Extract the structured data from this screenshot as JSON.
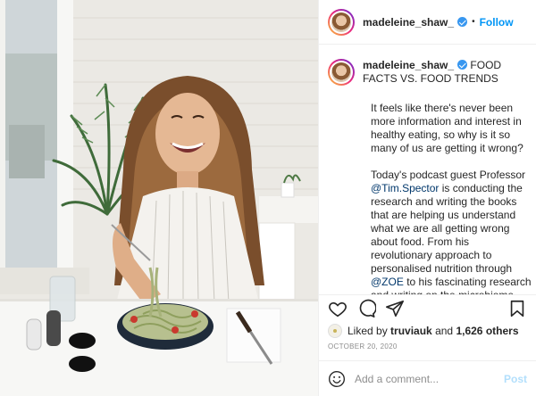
{
  "header": {
    "username": "madeleine_shaw_",
    "separator": "•",
    "follow_label": "Follow"
  },
  "caption": {
    "username": "madeleine_shaw_",
    "title": "FOOD FACTS VS. FOOD TRENDS",
    "para1": "It feels like there's never been more information and interest in healthy eating, so why is it so many of us are getting it wrong?",
    "para2_a": "Today's podcast guest Professor ",
    "mention1": "@Tim.Spector",
    "para2_b": " is conducting the research and writing the books that are helping us understand what we are all getting wrong about food. From his revolutionary approach to personalised nutrition through ",
    "mention2": "@ZOE",
    "para2_c": " to his fascinating research and writing on the microbiome and work as the director of the British Gut Project Tim is revolutionising the way we think about"
  },
  "actions": {
    "like_icon": "heart-icon",
    "comment_icon": "comment-icon",
    "share_icon": "paper-plane-icon",
    "save_icon": "bookmark-icon"
  },
  "likes": {
    "prefix": "Liked by ",
    "user": "truviauk",
    "middle": " and ",
    "others": "1,626 others"
  },
  "date": "OCTOBER 20, 2020",
  "comment": {
    "placeholder": "Add a comment...",
    "post_label": "Post",
    "emoji_icon": "smiley-icon"
  },
  "colors": {
    "follow_blue": "#0095f6",
    "verified_blue": "#3897f0",
    "mention": "#00376b",
    "post_disabled": "#b2dffc",
    "muted": "#8e8e8e"
  }
}
